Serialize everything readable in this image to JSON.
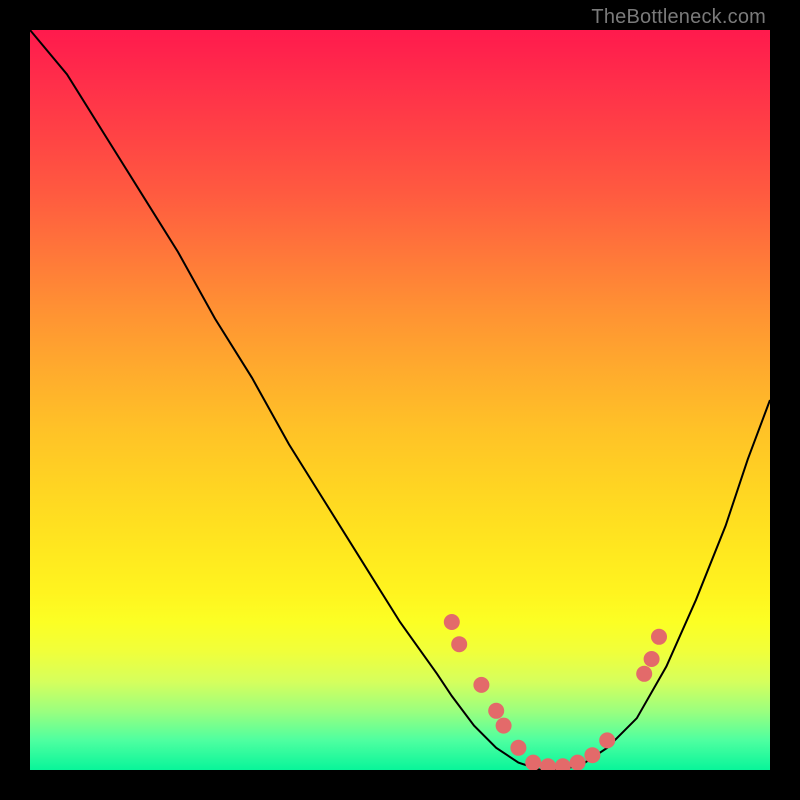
{
  "watermark": "TheBottleneck.com",
  "chart_data": {
    "type": "line",
    "title": "",
    "xlabel": "",
    "ylabel": "",
    "xlim": [
      0,
      100
    ],
    "ylim": [
      0,
      100
    ],
    "series": [
      {
        "name": "bottleneck-curve",
        "x": [
          0,
          5,
          10,
          15,
          20,
          25,
          30,
          35,
          40,
          45,
          50,
          55,
          57,
          60,
          63,
          66,
          69,
          72,
          75,
          78,
          82,
          86,
          90,
          94,
          97,
          100
        ],
        "y": [
          100,
          94,
          86,
          78,
          70,
          61,
          53,
          44,
          36,
          28,
          20,
          13,
          10,
          6,
          3,
          1,
          0,
          0,
          1,
          3,
          7,
          14,
          23,
          33,
          42,
          50
        ]
      }
    ],
    "markers": {
      "name": "highlight-dots",
      "color": "#e36a6a",
      "points": [
        {
          "x": 57,
          "y": 20
        },
        {
          "x": 58,
          "y": 17
        },
        {
          "x": 61,
          "y": 11.5
        },
        {
          "x": 63,
          "y": 8
        },
        {
          "x": 64,
          "y": 6
        },
        {
          "x": 66,
          "y": 3
        },
        {
          "x": 68,
          "y": 1
        },
        {
          "x": 70,
          "y": 0.5
        },
        {
          "x": 72,
          "y": 0.5
        },
        {
          "x": 74,
          "y": 1
        },
        {
          "x": 76,
          "y": 2
        },
        {
          "x": 78,
          "y": 4
        },
        {
          "x": 83,
          "y": 13
        },
        {
          "x": 84,
          "y": 15
        },
        {
          "x": 85,
          "y": 18
        }
      ]
    },
    "background_gradient": {
      "top": "#ff1a4d",
      "mid": "#ffd522",
      "bottom": "#08f59a"
    }
  }
}
